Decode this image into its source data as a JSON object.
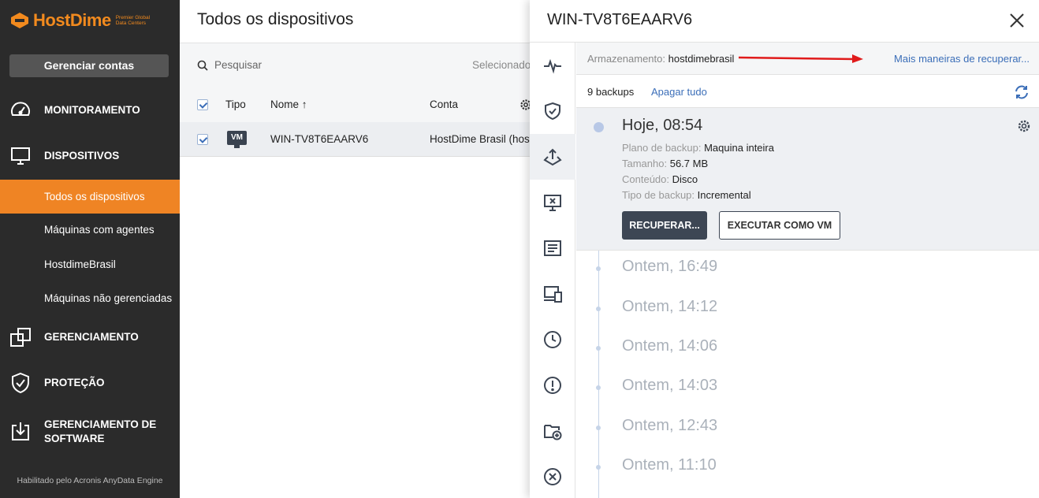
{
  "brand": {
    "name": "HostDime",
    "tagline": "Premier Global Data Centers",
    "accent": "#ef8424"
  },
  "sidebar": {
    "manage_button": "Gerenciar contas",
    "sections": [
      {
        "label": "MONITORAMENTO",
        "icon": "gauge-icon"
      },
      {
        "label": "DISPOSITIVOS",
        "icon": "monitor-icon"
      },
      {
        "label": "GERENCIAMENTO",
        "icon": "overlap-squares-icon"
      },
      {
        "label": "PROTEÇÃO",
        "icon": "shield-icon"
      },
      {
        "label": "GERENCIAMENTO DE SOFTWARE",
        "icon": "download-tray-icon"
      }
    ],
    "sub_items": [
      {
        "label": "Todos os dispositivos",
        "active": true
      },
      {
        "label": "Máquinas com agentes",
        "active": false
      },
      {
        "label": "HostdimeBrasil",
        "active": false
      },
      {
        "label": "Máquinas não gerenciadas",
        "active": false
      }
    ],
    "powered_by": "Habilitado pelo Acronis AnyData Engine"
  },
  "main": {
    "title": "Todos os dispositivos",
    "search_placeholder": "Pesquisar",
    "selected_label": "Selecionado:",
    "columns": {
      "type": "Tipo",
      "name": "Nome ↑",
      "account": "Conta"
    },
    "rows": [
      {
        "type": "VM",
        "name": "WIN-TV8T6EAARV6",
        "account": "HostDime Brasil (host",
        "checked": true
      }
    ]
  },
  "panel": {
    "title": "WIN-TV8T6EAARV6",
    "storage_label": "Armazenamento:",
    "storage_value": "hostdimebrasil",
    "more_link": "Mais maneiras de recuperar...",
    "backup_count": "9 backups",
    "delete_all": "Apagar tudo",
    "rail_icons": [
      "activity-icon",
      "shield-check-icon",
      "recovery-icon",
      "remote-desktop-icon",
      "report-icon",
      "devices-icon",
      "clock-icon",
      "alert-icon",
      "folder-add-icon",
      "close-circle-icon"
    ],
    "active_backup": {
      "time": "Hoje, 08:54",
      "plan_label": "Plano de backup:",
      "plan": "Maquina inteira",
      "size_label": "Tamanho:",
      "size": "56.7 MB",
      "content_label": "Conteúdo:",
      "content": "Disco",
      "type_label": "Tipo de backup:",
      "type": "Incremental",
      "recover_button": "RECUPERAR...",
      "run_vm_button": "EXECUTAR COMO VM"
    },
    "backups": [
      "Ontem, 16:49",
      "Ontem, 14:12",
      "Ontem, 14:06",
      "Ontem, 14:03",
      "Ontem, 12:43",
      "Ontem, 11:10"
    ]
  }
}
